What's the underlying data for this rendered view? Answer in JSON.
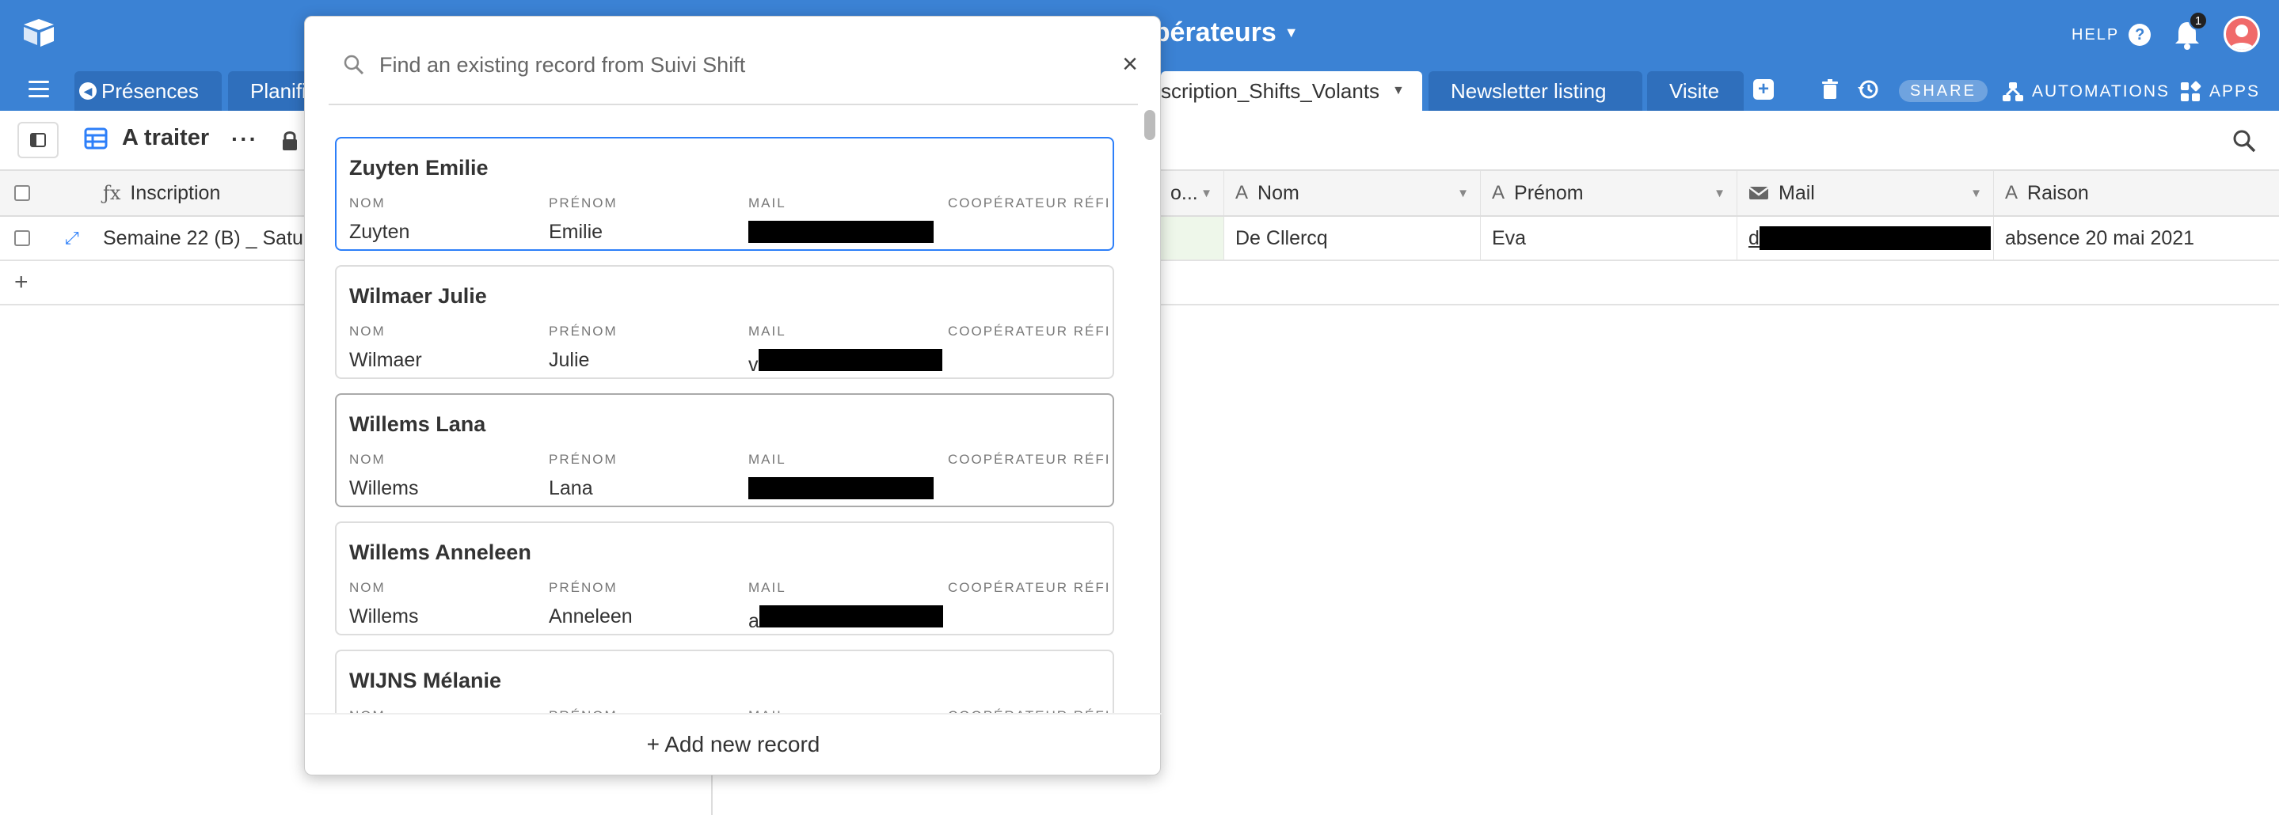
{
  "header": {
    "base_title": "opérateurs",
    "help_label": "HELP",
    "help_q": "?",
    "notification_count": "1"
  },
  "tabs": [
    {
      "label": "Présences",
      "active": false
    },
    {
      "label": "Planifi",
      "active": false
    },
    {
      "label": "scription_Shifts_Volants",
      "active": true
    },
    {
      "label": "Newsletter listing",
      "active": false
    },
    {
      "label": "Visite",
      "active": false
    }
  ],
  "toolbar": {
    "add_tab": "+",
    "share_label": "SHARE",
    "automations_label": "AUTOMATIONS",
    "apps_label": "APPS"
  },
  "view": {
    "name": "A traiter",
    "more": "···"
  },
  "grid": {
    "columns": {
      "inscription": "Inscription",
      "truncated": "o...",
      "nom": "Nom",
      "prenom": "Prénom",
      "mail": "Mail",
      "raison": "Raison"
    },
    "row": {
      "inscription": "Semaine 22 (B) _ Satur",
      "nom": "De Cllercq",
      "prenom": "Eva",
      "mail_prefix": "d",
      "raison": "absence 20 mai 2021"
    },
    "add_row": "+"
  },
  "modal": {
    "search_placeholder": "Find an existing record from Suivi Shift",
    "close": "×",
    "field_labels": {
      "nom": "NOM",
      "prenom": "PRÉNOM",
      "mail": "MAIL",
      "cooperateur": "COOPÉRATEUR RÉFI"
    },
    "records": [
      {
        "title": "Zuyten Emilie",
        "nom": "Zuyten",
        "prenom": "Emilie",
        "mail_prefix": ""
      },
      {
        "title": "Wilmaer Julie",
        "nom": "Wilmaer",
        "prenom": "Julie",
        "mail_prefix": "v"
      },
      {
        "title": "Willems Lana",
        "nom": "Willems",
        "prenom": "Lana",
        "mail_prefix": ""
      },
      {
        "title": "Willems Anneleen",
        "nom": "Willems",
        "prenom": "Anneleen",
        "mail_prefix": "a"
      },
      {
        "title": "WIJNS Mélanie",
        "nom": "",
        "prenom": "",
        "mail_prefix": ""
      }
    ],
    "add_new_label": "+ Add new record"
  },
  "colors": {
    "header_blue": "#3b82d4",
    "tab_blue": "#2f6fbc",
    "selection_blue": "#2d7ff9",
    "avatar_red": "#f06a6a"
  }
}
